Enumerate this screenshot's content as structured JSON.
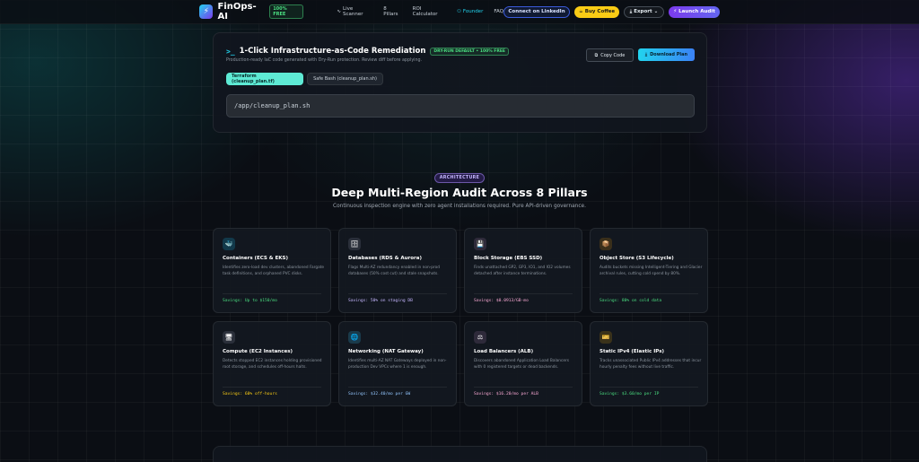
{
  "nav": {
    "brand": "FinOps-AI",
    "free_badge": "100% FREE",
    "links": [
      {
        "label": "Live Scanner",
        "icon": "pulse-icon",
        "active": false
      },
      {
        "label": "8 Pillars",
        "icon": "",
        "active": false
      },
      {
        "label": "ROI Calculator",
        "icon": "",
        "active": false
      },
      {
        "label": "Founder",
        "icon": "person-icon",
        "active": true
      },
      {
        "label": "FAQ",
        "icon": "",
        "active": false
      }
    ],
    "linkedin": "Connect on  LinkedIn",
    "coffee": "Buy Coffee",
    "export": "Export",
    "launch": "Launch Audit"
  },
  "iac": {
    "title": "1-Click Infrastructure-as-Code Remediation",
    "badge": "DRY-RUN DEFAULT • 100% FREE",
    "subtitle": "Production-ready IaC code generated with Dry-Run protection. Review diff before applying.",
    "copy_label": "Copy Code",
    "download_label": "Download Plan",
    "tabs": [
      {
        "label": "Terraform (cleanup_plan.tf)",
        "active": true
      },
      {
        "label": "Safe Bash (cleanup_plan.sh)",
        "active": false
      }
    ],
    "code": "/app/cleanup_plan.sh"
  },
  "architecture": {
    "badge": "ARCHITECTURE",
    "title": "Deep Multi-Region Audit Across 8 Pillars",
    "subtitle": "Continuous inspection engine with zero agent installations required. Pure API-driven governance."
  },
  "cards": [
    {
      "icon": "whale-icon",
      "glyph": "🐳",
      "icon_bg": "#12394a",
      "title": "Containers (ECS & EKS)",
      "desc": "Identifies zero-load dev clusters, abandoned Fargate task definitions, and orphaned PVC disks.",
      "saving": "Savings: Up to $150/mo",
      "saving_color": "#4ade80"
    },
    {
      "icon": "database-icon",
      "glyph": "🗄",
      "icon_bg": "#2a2f3a",
      "title": "Databases (RDS & Aurora)",
      "desc": "Flags Multi-AZ redundancy enabled in non-prod databases (50% cost cut) and stale snapshots.",
      "saving": "Savings: 50% on staging DB",
      "saving_color": "#c4b5fd"
    },
    {
      "icon": "disk-icon",
      "glyph": "💾",
      "icon_bg": "#2e2a3a",
      "title": "Block Storage (EBS SSD)",
      "desc": "Finds unattached GP2, GP3, IO1, and IO2 volumes detached after instance terminations.",
      "saving": "Savings: $0.0913/GB-mo",
      "saving_color": "#f9a8d4"
    },
    {
      "icon": "bucket-icon",
      "glyph": "📦",
      "icon_bg": "#3a2f1a",
      "title": "Object Store (S3 Lifecycle)",
      "desc": "Audits buckets missing Intelligent-Tiering and Glacier archival rules, cutting cold spend by 80%.",
      "saving": "Savings: 80% on cold data",
      "saving_color": "#4ade80"
    },
    {
      "icon": "monitor-icon",
      "glyph": "🖥",
      "icon_bg": "#2a2f3a",
      "title": "Compute (EC2 Instances)",
      "desc": "Detects stopped EC2 instances holding provisioned root storage, and schedules off-hours halts.",
      "saving": "Savings: 60% off-hours",
      "saving_color": "#facc15"
    },
    {
      "icon": "globe-icon",
      "glyph": "🌐",
      "icon_bg": "#1a3a4a",
      "title": "Networking (NAT Gateway)",
      "desc": "Identifies multi-AZ NAT Gateways deployed in non-production Dev VPCs where 1 is enough.",
      "saving": "Savings: $32.40/mo per GW",
      "saving_color": "#93c5fd"
    },
    {
      "icon": "balancer-icon",
      "glyph": "⚖",
      "icon_bg": "#2e2a3a",
      "title": "Load Balancers (ALB)",
      "desc": "Discovers abandoned Application Load Balancers with 0 registered targets or dead backends.",
      "saving": "Savings: $16.20/mo per ALB",
      "saving_color": "#f9a8d4"
    },
    {
      "icon": "ticket-icon",
      "glyph": "🎫",
      "icon_bg": "#3a321a",
      "title": "Static IPv4 (Elastic IPs)",
      "desc": "Tracks unassociated Public IPv4 addresses that incur hourly penalty fees without live traffic.",
      "saving": "Savings: $3.60/mo per IP",
      "saving_color": "#4ade80"
    }
  ],
  "colors": {
    "accent_cyan": "#22d3ee",
    "accent_purple": "#7c3aed",
    "badge_green": "#4ade80",
    "coffee_yellow": "#facc15"
  }
}
